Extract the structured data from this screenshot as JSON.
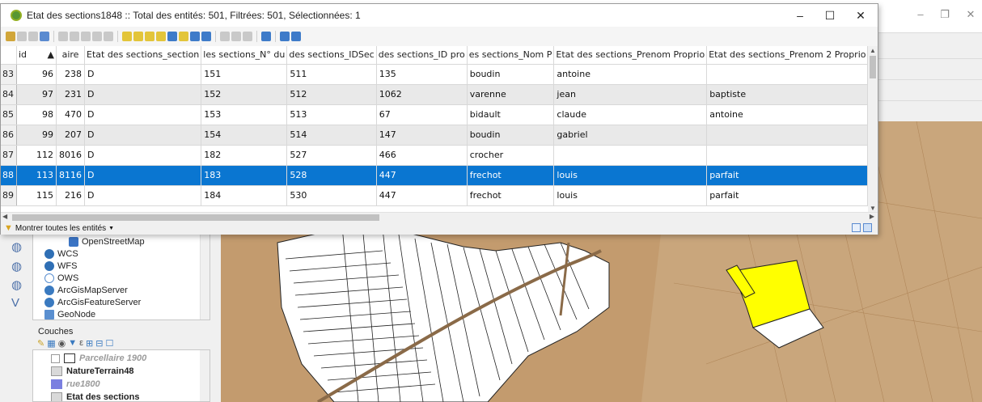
{
  "dialog": {
    "title": "Etat des sections1848 :: Total des entités: 501, Filtrées: 501, Sélectionnées: 1",
    "minimize": "–",
    "maximize": "☐",
    "close": "✕"
  },
  "main_window": {
    "minimize": "–",
    "restore": "❐",
    "close": "✕"
  },
  "table": {
    "headers": [
      "id",
      "aire",
      "Etat des sections_section",
      "les sections_N° du",
      "des sections_IDSec",
      "des sections_ID pro",
      "es sections_Nom P",
      "Etat des sections_Prenom Proprio",
      "Etat des sections_Prenom 2 Proprio",
      "s"
    ],
    "sort_indicator": "▲",
    "rows": [
      {
        "n": "83",
        "id": "96",
        "aire": "238",
        "section": "D",
        "num": "151",
        "idsec": "511",
        "idpro": "135",
        "nom": "boudin",
        "prenom": "antoine",
        "prenom2": "",
        "extra": ""
      },
      {
        "n": "84",
        "id": "97",
        "aire": "231",
        "section": "D",
        "num": "152",
        "idsec": "512",
        "idpro": "1062",
        "nom": "varenne",
        "prenom": "jean",
        "prenom2": "baptiste",
        "extra": "r"
      },
      {
        "n": "85",
        "id": "98",
        "aire": "470",
        "section": "D",
        "num": "153",
        "idsec": "513",
        "idpro": "67",
        "nom": "bidault",
        "prenom": "claude",
        "prenom2": "antoine",
        "extra": ""
      },
      {
        "n": "86",
        "id": "99",
        "aire": "207",
        "section": "D",
        "num": "154",
        "idsec": "514",
        "idpro": "147",
        "nom": "boudin",
        "prenom": "gabriel",
        "prenom2": "",
        "extra": ""
      },
      {
        "n": "87",
        "id": "112",
        "aire": "8016",
        "section": "D",
        "num": "182",
        "idsec": "527",
        "idpro": "466",
        "nom": "crocher",
        "prenom": "",
        "prenom2": "",
        "extra": ""
      },
      {
        "n": "88",
        "id": "113",
        "aire": "8116",
        "section": "D",
        "num": "183",
        "idsec": "528",
        "idpro": "447",
        "nom": "frechot",
        "prenom": "louis",
        "prenom2": "parfait",
        "extra": ""
      },
      {
        "n": "89",
        "id": "115",
        "aire": "216",
        "section": "D",
        "num": "184",
        "idsec": "530",
        "idpro": "447",
        "nom": "frechot",
        "prenom": "louis",
        "prenom2": "parfait",
        "extra": ""
      }
    ]
  },
  "footer": {
    "filter_label": "Montrer toutes les entités"
  },
  "browser": {
    "items": [
      {
        "label": "OpenStreetMap",
        "icon": "osm-icon",
        "color": "#3b74c4"
      },
      {
        "label": "WCS",
        "icon": "wcs-icon",
        "color": "#2f6fb5"
      },
      {
        "label": "WFS",
        "icon": "wfs-icon",
        "color": "#2f6fb5"
      },
      {
        "label": "OWS",
        "icon": "ows-icon",
        "color": "#5a8fd0"
      },
      {
        "label": "ArcGisMapServer",
        "icon": "arcgis-icon",
        "color": "#3a7ac0"
      },
      {
        "label": "ArcGisFeatureServer",
        "icon": "arcgis-feature-icon",
        "color": "#3a7ac0"
      },
      {
        "label": "GeoNode",
        "icon": "geonode-icon",
        "color": "#5a8fd0"
      }
    ]
  },
  "layers": {
    "title": "Couches",
    "items": [
      {
        "label": "Parcellaire 1900",
        "style": "dim-italic"
      },
      {
        "label": "NatureTerrain48",
        "style": "bold"
      },
      {
        "label": "rue1800",
        "style": "dim-italic"
      },
      {
        "label": "Etat des sections",
        "style": "bold"
      }
    ]
  },
  "colors": {
    "selection": "#0a76d1",
    "highlight_parcel": "#ffff00",
    "map_bg": "#c49c70"
  }
}
